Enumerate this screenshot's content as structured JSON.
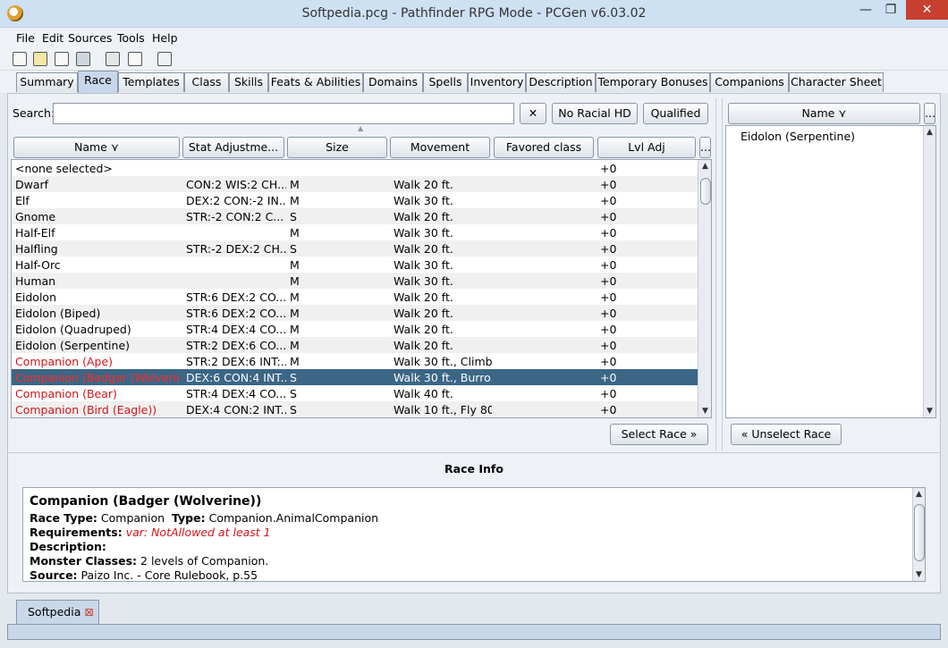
{
  "window": {
    "title": "Softpedia.pcg - Pathfinder RPG Mode - PCGen v6.03.02",
    "minimize": "—",
    "maximize": "❐",
    "close": "✕"
  },
  "menu": [
    "File",
    "Edit",
    "Sources",
    "Tools",
    "Help"
  ],
  "tabs": [
    "Summary",
    "Race",
    "Templates",
    "Class",
    "Skills",
    "Feats & Abilities",
    "Domains",
    "Spells",
    "Inventory",
    "Description",
    "Temporary Bonuses",
    "Companions",
    "Character Sheet"
  ],
  "search": {
    "label": "Search:",
    "value": "",
    "clear": "✕",
    "no_racial_hd": "No Racial HD",
    "qualified": "Qualified"
  },
  "columns": [
    "Name ⋎",
    "Stat Adjustme...",
    "Size",
    "Movement",
    "Favored class",
    "Lvl Adj",
    "..."
  ],
  "rows": [
    {
      "name": "<none selected>",
      "stat": "",
      "size": "",
      "move": "",
      "fav": "",
      "lvl": "+0",
      "red": false
    },
    {
      "name": "Dwarf",
      "stat": "CON:2 WIS:2 CH...",
      "size": "M",
      "move": "Walk 20 ft.",
      "fav": "",
      "lvl": "+0",
      "red": false
    },
    {
      "name": "Elf",
      "stat": "DEX:2 CON:-2 IN...",
      "size": "M",
      "move": "Walk 30 ft.",
      "fav": "",
      "lvl": "+0",
      "red": false
    },
    {
      "name": "Gnome",
      "stat": "STR:-2 CON:2 C...",
      "size": "S",
      "move": "Walk 20 ft.",
      "fav": "",
      "lvl": "+0",
      "red": false
    },
    {
      "name": "Half-Elf",
      "stat": "",
      "size": "M",
      "move": "Walk 30 ft.",
      "fav": "",
      "lvl": "+0",
      "red": false
    },
    {
      "name": "Halfling",
      "stat": "STR:-2 DEX:2 CH...",
      "size": "S",
      "move": "Walk 20 ft.",
      "fav": "",
      "lvl": "+0",
      "red": false
    },
    {
      "name": "Half-Orc",
      "stat": "",
      "size": "M",
      "move": "Walk 30 ft.",
      "fav": "",
      "lvl": "+0",
      "red": false
    },
    {
      "name": "Human",
      "stat": "",
      "size": "M",
      "move": "Walk 30 ft.",
      "fav": "",
      "lvl": "+0",
      "red": false
    },
    {
      "name": "Eidolon",
      "stat": "STR:6 DEX:2 CO...",
      "size": "M",
      "move": "Walk 20 ft.",
      "fav": "",
      "lvl": "+0",
      "red": false
    },
    {
      "name": "Eidolon (Biped)",
      "stat": "STR:6 DEX:2 CO...",
      "size": "M",
      "move": "Walk 20 ft.",
      "fav": "",
      "lvl": "+0",
      "red": false
    },
    {
      "name": "Eidolon (Quadruped)",
      "stat": "STR:4 DEX:4 CO...",
      "size": "M",
      "move": "Walk 20 ft.",
      "fav": "",
      "lvl": "+0",
      "red": false
    },
    {
      "name": "Eidolon (Serpentine)",
      "stat": "STR:2 DEX:6 CO...",
      "size": "M",
      "move": "Walk 20 ft.",
      "fav": "",
      "lvl": "+0",
      "red": false
    },
    {
      "name": "Companion (Ape)",
      "stat": "STR:2 DEX:6 INT:...",
      "size": "M",
      "move": "Walk 30 ft., Climb...",
      "fav": "",
      "lvl": "+0",
      "red": true
    },
    {
      "name": "Companion (Badger (Wolverine",
      "stat": "DEX:6 CON:4 INT...",
      "size": "S",
      "move": "Walk 30 ft., Burro...",
      "fav": "",
      "lvl": "+0",
      "red": true,
      "selected": true
    },
    {
      "name": "Companion (Bear)",
      "stat": "STR:4 DEX:4 CO...",
      "size": "S",
      "move": "Walk 40 ft.",
      "fav": "",
      "lvl": "+0",
      "red": true
    },
    {
      "name": "Companion (Bird (Eagle))",
      "stat": "DEX:4 CON:2 INT...",
      "size": "S",
      "move": "Walk 10 ft., Fly 80...",
      "fav": "",
      "lvl": "+0",
      "red": true
    }
  ],
  "select_race": "Select Race",
  "selected_panel": {
    "header": "Name ⋎",
    "items": [
      "Eidolon (Serpentine)"
    ],
    "unselect": "Unselect Race",
    "more": "..."
  },
  "race_info": {
    "title": "Race Info",
    "name": "Companion (Badger (Wolverine))",
    "race_type_label": "Race Type:",
    "race_type": "Companion",
    "type_label": "Type:",
    "type": "Companion.AnimalCompanion",
    "requirements_label": "Requirements:",
    "requirements": "var: NotAllowed at least 1",
    "description_label": "Description:",
    "monster_classes_label": "Monster Classes:",
    "monster_classes": "2 levels of Companion.",
    "source_label": "Source:",
    "source": "Paizo Inc. - Core Rulebook, p.55"
  },
  "character_tab": "Softpedia",
  "character_tab_close": "⊠"
}
